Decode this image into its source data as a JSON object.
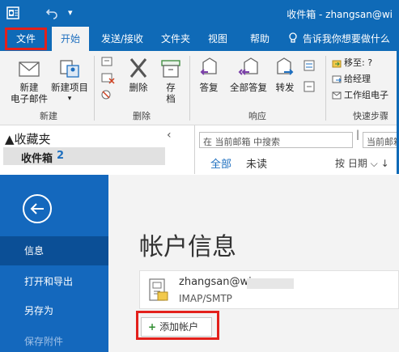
{
  "window": {
    "title": "收件箱 - zhangsan@wi"
  },
  "quick_access": {
    "icons": [
      "outlook-logo-icon",
      "undo-icon",
      "customize-icon"
    ]
  },
  "tabs": [
    {
      "label": "文件",
      "highlighted": true
    },
    {
      "label": "开始",
      "active": true
    },
    {
      "label": "发送/接收"
    },
    {
      "label": "文件夹"
    },
    {
      "label": "视图"
    },
    {
      "label": "帮助"
    }
  ],
  "tell_me": {
    "label": "告诉我你想要做什么"
  },
  "ribbon": {
    "new_group": {
      "label": "新建",
      "new_email": [
        "新建",
        "电子邮件"
      ],
      "new_items": [
        "新建项目"
      ]
    },
    "delete_group": {
      "label": "删除",
      "delete": "删除",
      "archive": [
        "存",
        "档"
      ]
    },
    "respond_group": {
      "label": "响应",
      "reply": "答复",
      "reply_all": "全部答复",
      "forward": "转发"
    },
    "quick_steps_group": {
      "label": "快速步骤",
      "items": [
        "移至: ?",
        "给经理",
        "工作组电子"
      ]
    }
  },
  "nav": {
    "favorites": "收藏夹",
    "inbox": {
      "label": "收件箱",
      "count": "2"
    }
  },
  "search": {
    "placeholder": "在 当前邮箱 中搜索",
    "scope_placeholder": "当前邮箱"
  },
  "filters": {
    "all": "全部",
    "unread": "未读",
    "sort": "按 日期"
  },
  "backstage": {
    "menu": [
      {
        "label": "信息",
        "active": true
      },
      {
        "label": "打开和导出"
      },
      {
        "label": "另存为"
      },
      {
        "label": "保存附件"
      }
    ],
    "title": "帐户信息",
    "account": {
      "email": "zhangsan@wi           n.cn",
      "type": "IMAP/SMTP"
    },
    "add_account": "添加帐户"
  },
  "colors": {
    "brand_blue": "#0f6ab7",
    "backstage_blue": "#1468bd",
    "highlight_red": "#e3201b",
    "accent_text": "#1e6fbf"
  }
}
